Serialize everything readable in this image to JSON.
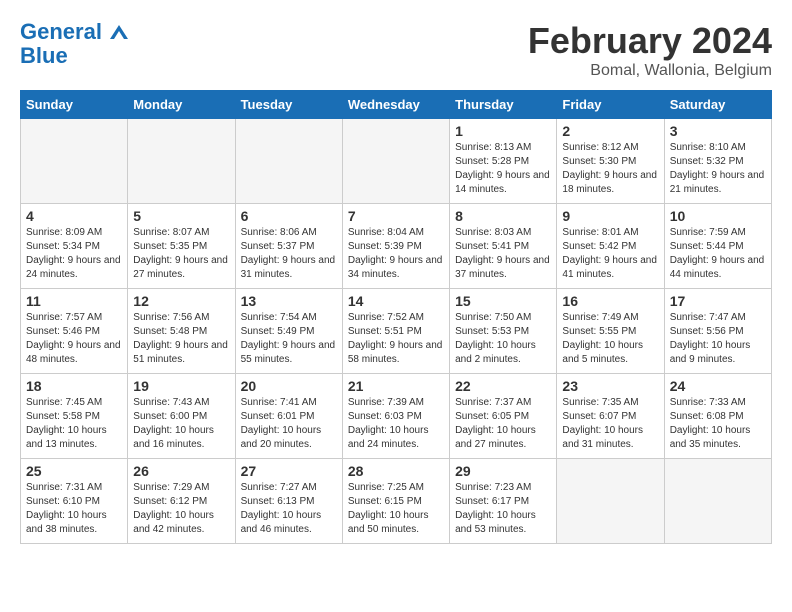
{
  "header": {
    "logo_line1": "General",
    "logo_line2": "Blue",
    "title": "February 2024",
    "subtitle": "Bomal, Wallonia, Belgium"
  },
  "calendar": {
    "days_of_week": [
      "Sunday",
      "Monday",
      "Tuesday",
      "Wednesday",
      "Thursday",
      "Friday",
      "Saturday"
    ],
    "weeks": [
      [
        {
          "day": "",
          "info": "",
          "empty": true
        },
        {
          "day": "",
          "info": "",
          "empty": true
        },
        {
          "day": "",
          "info": "",
          "empty": true
        },
        {
          "day": "",
          "info": "",
          "empty": true
        },
        {
          "day": "1",
          "info": "Sunrise: 8:13 AM\nSunset: 5:28 PM\nDaylight: 9 hours\nand 14 minutes.",
          "empty": false
        },
        {
          "day": "2",
          "info": "Sunrise: 8:12 AM\nSunset: 5:30 PM\nDaylight: 9 hours\nand 18 minutes.",
          "empty": false
        },
        {
          "day": "3",
          "info": "Sunrise: 8:10 AM\nSunset: 5:32 PM\nDaylight: 9 hours\nand 21 minutes.",
          "empty": false
        }
      ],
      [
        {
          "day": "4",
          "info": "Sunrise: 8:09 AM\nSunset: 5:34 PM\nDaylight: 9 hours\nand 24 minutes.",
          "empty": false
        },
        {
          "day": "5",
          "info": "Sunrise: 8:07 AM\nSunset: 5:35 PM\nDaylight: 9 hours\nand 27 minutes.",
          "empty": false
        },
        {
          "day": "6",
          "info": "Sunrise: 8:06 AM\nSunset: 5:37 PM\nDaylight: 9 hours\nand 31 minutes.",
          "empty": false
        },
        {
          "day": "7",
          "info": "Sunrise: 8:04 AM\nSunset: 5:39 PM\nDaylight: 9 hours\nand 34 minutes.",
          "empty": false
        },
        {
          "day": "8",
          "info": "Sunrise: 8:03 AM\nSunset: 5:41 PM\nDaylight: 9 hours\nand 37 minutes.",
          "empty": false
        },
        {
          "day": "9",
          "info": "Sunrise: 8:01 AM\nSunset: 5:42 PM\nDaylight: 9 hours\nand 41 minutes.",
          "empty": false
        },
        {
          "day": "10",
          "info": "Sunrise: 7:59 AM\nSunset: 5:44 PM\nDaylight: 9 hours\nand 44 minutes.",
          "empty": false
        }
      ],
      [
        {
          "day": "11",
          "info": "Sunrise: 7:57 AM\nSunset: 5:46 PM\nDaylight: 9 hours\nand 48 minutes.",
          "empty": false
        },
        {
          "day": "12",
          "info": "Sunrise: 7:56 AM\nSunset: 5:48 PM\nDaylight: 9 hours\nand 51 minutes.",
          "empty": false
        },
        {
          "day": "13",
          "info": "Sunrise: 7:54 AM\nSunset: 5:49 PM\nDaylight: 9 hours\nand 55 minutes.",
          "empty": false
        },
        {
          "day": "14",
          "info": "Sunrise: 7:52 AM\nSunset: 5:51 PM\nDaylight: 9 hours\nand 58 minutes.",
          "empty": false
        },
        {
          "day": "15",
          "info": "Sunrise: 7:50 AM\nSunset: 5:53 PM\nDaylight: 10 hours\nand 2 minutes.",
          "empty": false
        },
        {
          "day": "16",
          "info": "Sunrise: 7:49 AM\nSunset: 5:55 PM\nDaylight: 10 hours\nand 5 minutes.",
          "empty": false
        },
        {
          "day": "17",
          "info": "Sunrise: 7:47 AM\nSunset: 5:56 PM\nDaylight: 10 hours\nand 9 minutes.",
          "empty": false
        }
      ],
      [
        {
          "day": "18",
          "info": "Sunrise: 7:45 AM\nSunset: 5:58 PM\nDaylight: 10 hours\nand 13 minutes.",
          "empty": false
        },
        {
          "day": "19",
          "info": "Sunrise: 7:43 AM\nSunset: 6:00 PM\nDaylight: 10 hours\nand 16 minutes.",
          "empty": false
        },
        {
          "day": "20",
          "info": "Sunrise: 7:41 AM\nSunset: 6:01 PM\nDaylight: 10 hours\nand 20 minutes.",
          "empty": false
        },
        {
          "day": "21",
          "info": "Sunrise: 7:39 AM\nSunset: 6:03 PM\nDaylight: 10 hours\nand 24 minutes.",
          "empty": false
        },
        {
          "day": "22",
          "info": "Sunrise: 7:37 AM\nSunset: 6:05 PM\nDaylight: 10 hours\nand 27 minutes.",
          "empty": false
        },
        {
          "day": "23",
          "info": "Sunrise: 7:35 AM\nSunset: 6:07 PM\nDaylight: 10 hours\nand 31 minutes.",
          "empty": false
        },
        {
          "day": "24",
          "info": "Sunrise: 7:33 AM\nSunset: 6:08 PM\nDaylight: 10 hours\nand 35 minutes.",
          "empty": false
        }
      ],
      [
        {
          "day": "25",
          "info": "Sunrise: 7:31 AM\nSunset: 6:10 PM\nDaylight: 10 hours\nand 38 minutes.",
          "empty": false
        },
        {
          "day": "26",
          "info": "Sunrise: 7:29 AM\nSunset: 6:12 PM\nDaylight: 10 hours\nand 42 minutes.",
          "empty": false
        },
        {
          "day": "27",
          "info": "Sunrise: 7:27 AM\nSunset: 6:13 PM\nDaylight: 10 hours\nand 46 minutes.",
          "empty": false
        },
        {
          "day": "28",
          "info": "Sunrise: 7:25 AM\nSunset: 6:15 PM\nDaylight: 10 hours\nand 50 minutes.",
          "empty": false
        },
        {
          "day": "29",
          "info": "Sunrise: 7:23 AM\nSunset: 6:17 PM\nDaylight: 10 hours\nand 53 minutes.",
          "empty": false
        },
        {
          "day": "",
          "info": "",
          "empty": true,
          "shaded": true
        },
        {
          "day": "",
          "info": "",
          "empty": true,
          "shaded": true
        }
      ]
    ]
  }
}
